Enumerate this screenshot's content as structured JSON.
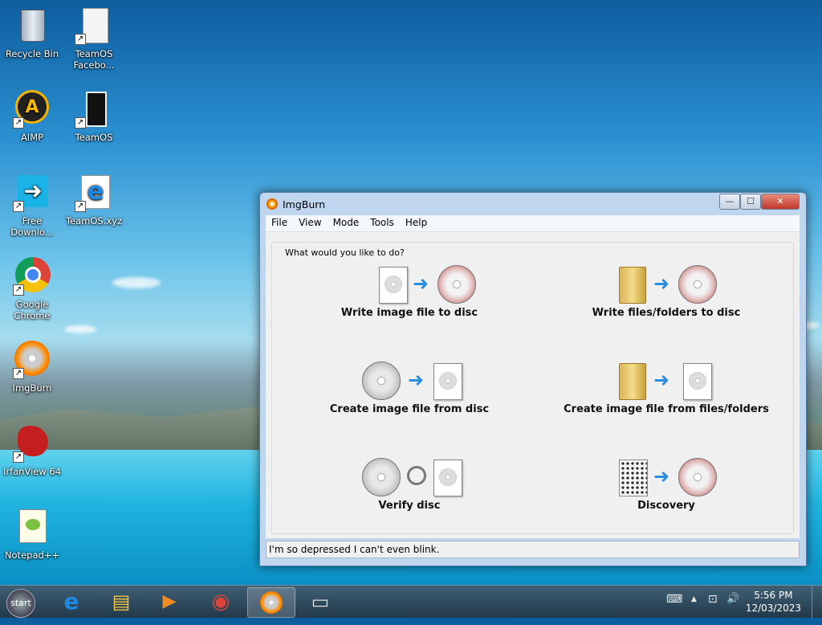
{
  "desktop": {
    "icons": [
      {
        "label": "Recycle Bin"
      },
      {
        "label": "TeamOS Facebo..."
      },
      {
        "label": "AIMP"
      },
      {
        "label": "TeamOS"
      },
      {
        "label": "Free Downlo..."
      },
      {
        "label": "TeamOS.xyz"
      },
      {
        "label": "Google Chrome"
      },
      {
        "label": "ImgBurn"
      },
      {
        "label": "IrfanView 64"
      },
      {
        "label": "Notepad++"
      }
    ]
  },
  "window": {
    "title": "ImgBurn",
    "minimize": "—",
    "maximize": "☐",
    "close": "✕",
    "menu": [
      "File",
      "View",
      "Mode",
      "Tools",
      "Help"
    ],
    "prompt": "What would you like to do?",
    "actions": [
      {
        "label": "Write image file to disc"
      },
      {
        "label": "Write files/folders to disc"
      },
      {
        "label": "Create image file from disc"
      },
      {
        "label": "Create image file from files/folders"
      },
      {
        "label": "Verify disc"
      },
      {
        "label": "Discovery"
      }
    ],
    "status": "I'm so depressed I can't even blink."
  },
  "taskbar": {
    "start_label": "start",
    "time": "5:56 PM",
    "date": "12/03/2023"
  },
  "icons": {
    "arrow": "➜",
    "ie": "e",
    "chrome": "◉",
    "folder": "▤",
    "media": "▶",
    "cmd": "▭",
    "tray_up": "▲",
    "network": "⊡",
    "volume": "🔊",
    "keyboard": "⌨"
  }
}
